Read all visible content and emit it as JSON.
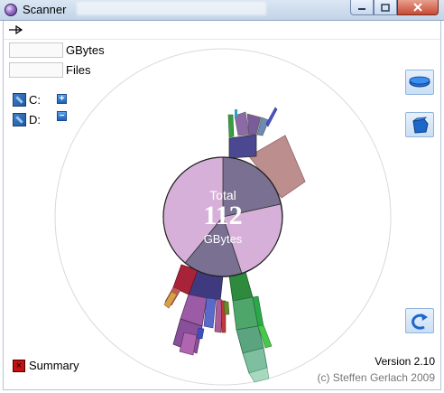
{
  "window": {
    "title": "Scanner"
  },
  "header": {
    "menu_icon": "arrow-right-icon"
  },
  "stats": {
    "gbytes": {
      "value": "",
      "label": "GBytes"
    },
    "files": {
      "value": "",
      "label": "Files"
    }
  },
  "drives": [
    {
      "label": "C:",
      "expander": "+"
    },
    {
      "label": "D:",
      "expander": "−"
    }
  ],
  "chart": {
    "title": "Total",
    "total_value": "112",
    "unit": "GBytes",
    "colors": {
      "ring": "#d2aed5",
      "inner_dark": "#7a7090",
      "accent_rose": "#be8f8f"
    }
  },
  "side_buttons": [
    {
      "name": "disk-icon"
    },
    {
      "name": "open-folder-icon"
    },
    {
      "name": "refresh-icon"
    }
  ],
  "footer": {
    "summary_label": "Summary",
    "summary_icon_glyph": "×",
    "version": "Version 2.10",
    "credit": "(c) Steffen Gerlach 2009"
  }
}
